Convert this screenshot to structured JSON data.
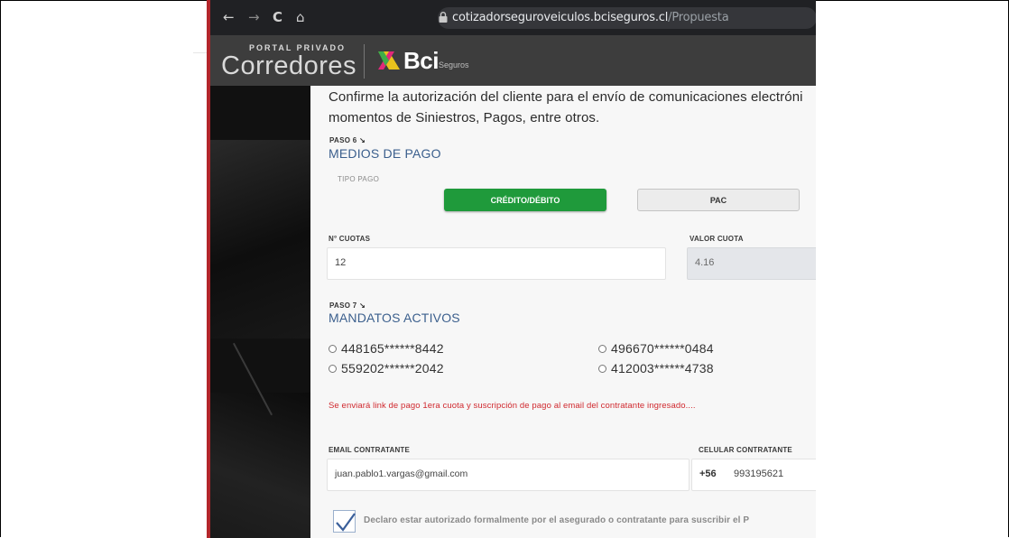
{
  "browser": {
    "url_domain": "cotizadorseguroveiculos.bciseguros.cl",
    "url_path": "/Propuesta",
    "nav": {
      "back": "←",
      "forward": "→",
      "reload": "C",
      "home": "⌂"
    }
  },
  "header": {
    "portal_small": "PORTAL PRIVADO",
    "portal_big": "Corredores",
    "brand": "Bci",
    "brand_sub": "Seguros"
  },
  "intro": {
    "line1": "Confirme la autorización del cliente para el envío de comunicaciones electróni",
    "line2": "momentos de Siniestros, Pagos, entre otros."
  },
  "step6": {
    "paso": "PASO 6 ↘",
    "title": "MEDIOS DE PAGO",
    "tipo_pago_label": "TIPO PAGO",
    "btn_credito": "CRÉDITO/DÉBITO",
    "btn_pac": "PAC",
    "cuotas_label": "N° CUOTAS",
    "cuotas_value": "12",
    "valor_label": "VALOR CUOTA",
    "valor_value": "4.16"
  },
  "step7": {
    "paso": "PASO 7 ↘",
    "title": "MANDATOS ACTIVOS",
    "mandates": [
      "448165******8442",
      "496670******0484",
      "559202******2042",
      "412003******4738"
    ]
  },
  "notice": "Se enviará link de pago 1era cuota y suscripción de pago al email del contratante ingresado....",
  "contact": {
    "email_label": "EMAIL CONTRATANTE",
    "email_value": "juan.pablo1.vargas@gmail.com",
    "cel_label": "CELULAR CONTRATANTE",
    "cel_prefix": "+56",
    "cel_value": "993195621"
  },
  "declaration": "Declaro estar autorizado formalmente por el asegurado o contratante para suscribir el P",
  "colors": {
    "primary_green": "#1f9a3b",
    "title_blue": "#3b5f8d",
    "notice_red": "#d0292f",
    "header_bg": "#3d3d3d"
  }
}
